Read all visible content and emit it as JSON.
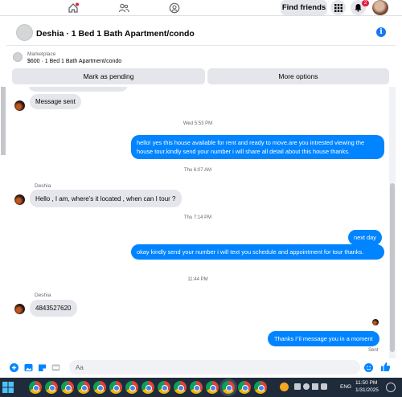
{
  "topnav": {
    "find_friends": "Find friends",
    "notification_count": "2"
  },
  "header": {
    "title": "Deshia · 1 Bed 1 Bath Apartment/condo"
  },
  "marketplace": {
    "label": "Marketplace",
    "listing": "$600 · 1 Bed 1 Bath Apartment/condo",
    "mark_pending": "Mark as pending",
    "more_options": "More options"
  },
  "messages": {
    "m1": "Message sent",
    "ts1": "Wed 5:53 PM",
    "m2": "hello! yes this house available for rent and ready to move.are you intrested viewing the house tour.kindly send your number i will share all detail about this house thanks.",
    "ts2": "Thu 6:07 AM",
    "sender1": "Deshia",
    "m3": "Hello , I am, where's it located , when can I tour ?",
    "ts3": "Thu 7:14 PM",
    "m4": "next day",
    "m5": "okay kindly send your number i will text you schedule and appointment for tour thanks.",
    "ts4": "11:44 PM",
    "sender2": "Deshia",
    "m6": "4843527620",
    "m7": "Thanks i\"il message you in a moment",
    "status": "Sent"
  },
  "composer": {
    "placeholder": "Aa"
  },
  "taskbar": {
    "lang": "ENG",
    "time": "11:50 PM",
    "date": "1/31/2025"
  },
  "colors": {
    "accent": "#0084ff",
    "brand": "#1877f2",
    "incoming_bubble": "#e4e6eb",
    "taskbar": "#1f2b3a"
  }
}
